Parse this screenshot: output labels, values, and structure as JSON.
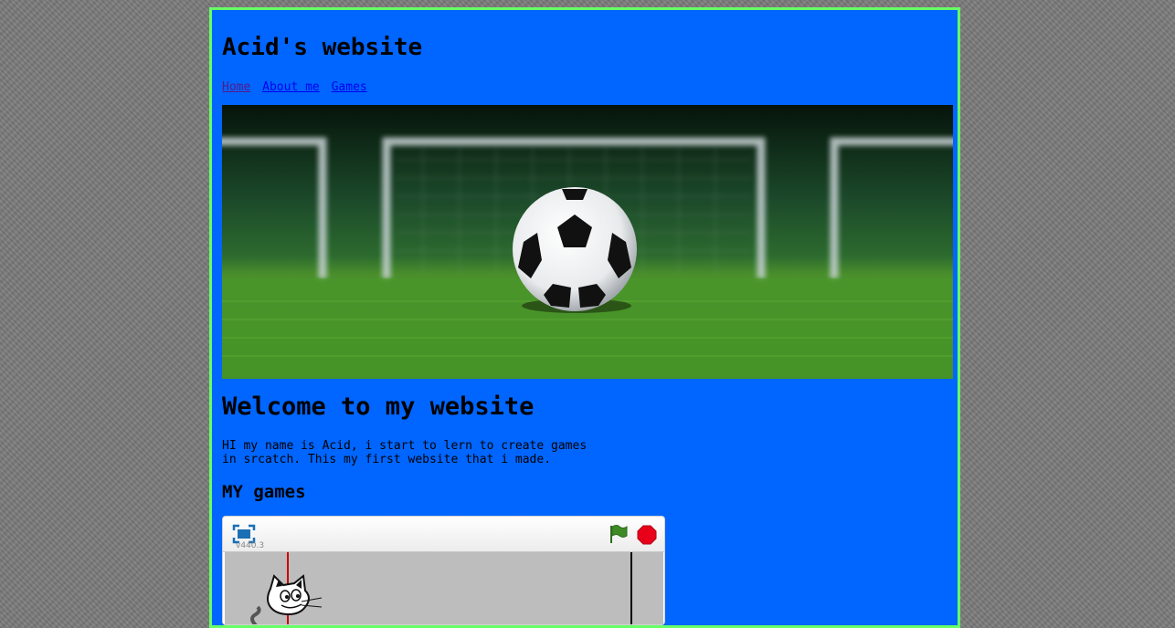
{
  "header": {
    "title": "Acid's website"
  },
  "nav": {
    "home": "Home",
    "about": "About me",
    "games": "Games"
  },
  "hero": {
    "image": "soccer-ball-on-grass-in-front-of-goal"
  },
  "main": {
    "welcome": "Welcome to my website",
    "intro": "HI my name is Acid, i start to lern to create games in srcatch. This my first website that i made.",
    "games_heading": "MY games"
  },
  "player": {
    "version": "v440.3",
    "icons": [
      "fullscreen-icon",
      "green-flag-icon",
      "stop-icon"
    ]
  },
  "colors": {
    "page_background": "#7a7a7a",
    "container_background": "#0066ff",
    "container_border": "#66ff66",
    "link": "#0000ee",
    "visited_link": "#551a8b"
  }
}
